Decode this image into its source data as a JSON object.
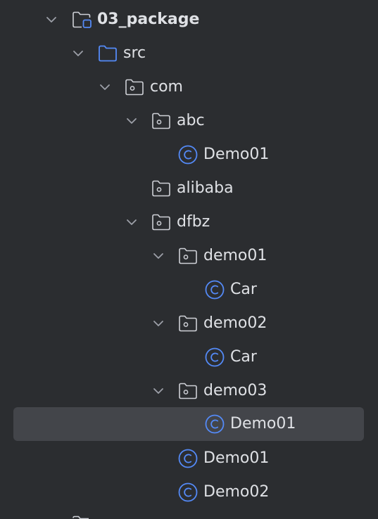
{
  "tree": {
    "rows": [
      {
        "label": "03_package",
        "icon": "module-folder-icon",
        "expanded": true,
        "selected": false
      },
      {
        "label": "src",
        "icon": "source-folder-icon",
        "expanded": true,
        "selected": false
      },
      {
        "label": "com",
        "icon": "package-folder-icon",
        "expanded": true,
        "selected": false
      },
      {
        "label": "abc",
        "icon": "package-folder-icon",
        "expanded": true,
        "selected": false
      },
      {
        "label": "Demo01",
        "icon": "class-icon",
        "selected": false
      },
      {
        "label": "alibaba",
        "icon": "package-folder-icon",
        "selected": false
      },
      {
        "label": "dfbz",
        "icon": "package-folder-icon",
        "expanded": true,
        "selected": false
      },
      {
        "label": "demo01",
        "icon": "package-folder-icon",
        "expanded": true,
        "selected": false
      },
      {
        "label": "Car",
        "icon": "class-icon",
        "selected": false
      },
      {
        "label": "demo02",
        "icon": "package-folder-icon",
        "expanded": true,
        "selected": false
      },
      {
        "label": "Car",
        "icon": "class-icon",
        "selected": false
      },
      {
        "label": "demo03",
        "icon": "package-folder-icon",
        "expanded": true,
        "selected": false
      },
      {
        "label": "Demo01",
        "icon": "class-icon",
        "selected": true
      },
      {
        "label": "Demo01",
        "icon": "class-icon",
        "selected": false
      },
      {
        "label": "Demo02",
        "icon": "class-icon",
        "selected": false
      }
    ]
  },
  "colors": {
    "background": "#2b2d30",
    "selection": "#43454a",
    "text": "#dfe1e5",
    "chevron": "#9da0a8",
    "folder_outline": "#ced0d6",
    "source_folder": "#548af7",
    "class_icon": "#548af7"
  }
}
